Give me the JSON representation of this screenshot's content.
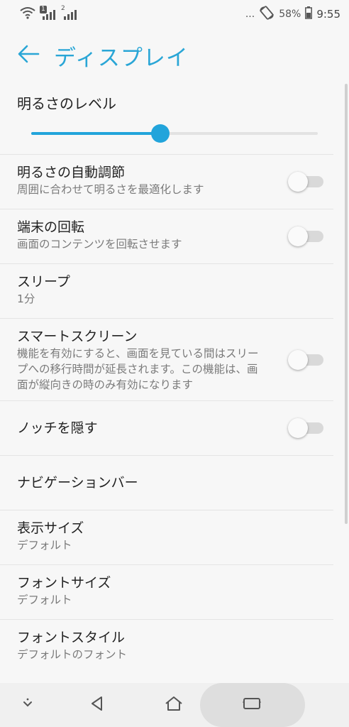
{
  "status_bar": {
    "sim1_label": "1",
    "sim2_label": "2",
    "more": "...",
    "battery_percent": "58%",
    "time": "9:55"
  },
  "app_bar": {
    "back_icon": "arrow-left-icon",
    "title": "ディスプレイ"
  },
  "brightness": {
    "title": "明るさのレベル",
    "level": 0.45,
    "accent": "#22a4db"
  },
  "settings": [
    {
      "title": "明るさの自動調節",
      "subtitle": "周囲に合わせて明るさを最適化します",
      "toggle": false
    },
    {
      "title": "端末の回転",
      "subtitle": "画面のコンテンツを回転させます",
      "toggle": false
    },
    {
      "title": "スリープ",
      "subtitle": "1分"
    },
    {
      "title": "スマートスクリーン",
      "subtitle": "機能を有効にすると、画面を見ている間はスリープへの移行時間が延長されます。この機能は、画面が縦向きの時のみ有効になります",
      "toggle": false
    },
    {
      "title": "ノッチを隠す",
      "toggle": false
    },
    {
      "title": "ナビゲーションバー"
    },
    {
      "title": "表示サイズ",
      "subtitle": "デフォルト"
    },
    {
      "title": "フォントサイズ",
      "subtitle": "デフォルト"
    },
    {
      "title": "フォントスタイル",
      "subtitle": "デフォルトのフォント"
    }
  ],
  "nav_bar": {
    "icons": [
      "chevron-down-icon",
      "back-triangle-icon",
      "home-icon",
      "recents-icon"
    ]
  }
}
